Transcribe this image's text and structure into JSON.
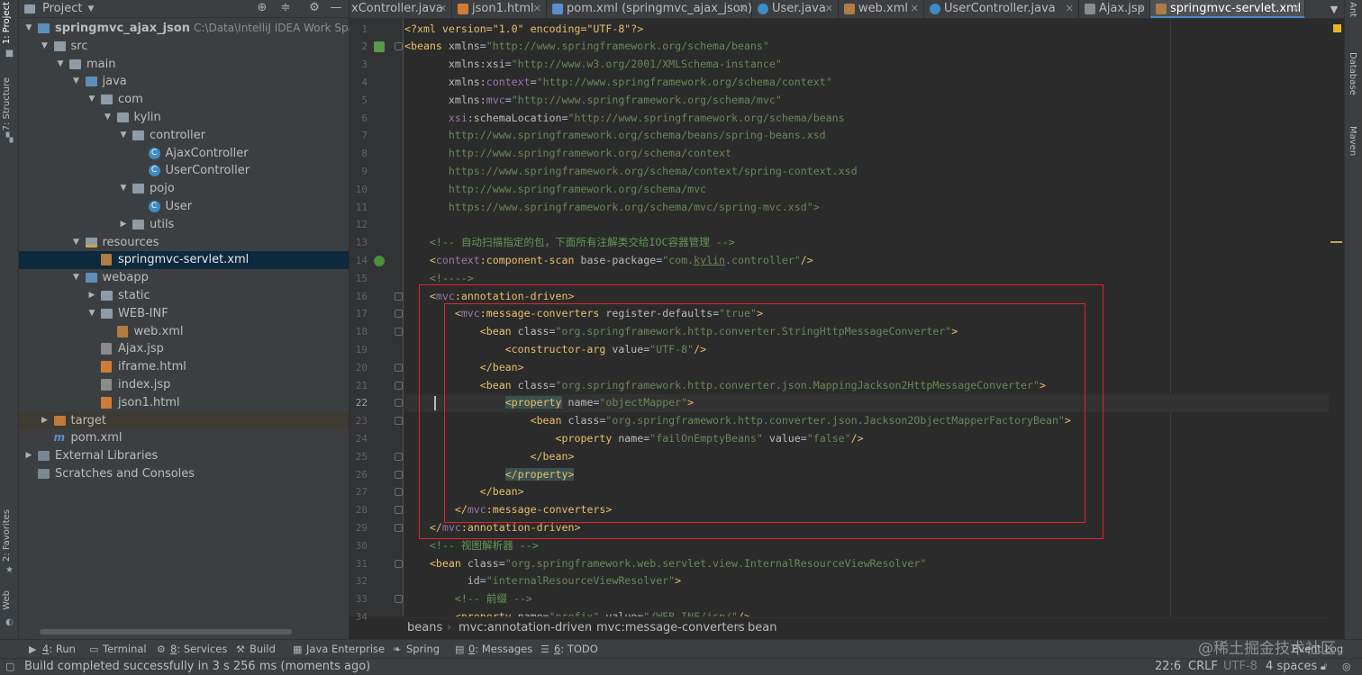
{
  "side_tabs_left": [
    "1: Project",
    "7: Structure",
    "2: Favorites",
    "Web"
  ],
  "side_tabs_right": [
    "Ant",
    "Database",
    "Maven"
  ],
  "project_panel": {
    "title": "Project",
    "tree": [
      {
        "label": "springmvc_ajax_json",
        "path": "C:\\Data\\IntelliJ IDEA Work Space\\sp",
        "icon": "module-folder"
      },
      {
        "label": "src",
        "icon": "folder"
      },
      {
        "label": "main",
        "icon": "folder"
      },
      {
        "label": "java",
        "icon": "source-folder"
      },
      {
        "label": "com",
        "icon": "package"
      },
      {
        "label": "kylin",
        "icon": "package"
      },
      {
        "label": "controller",
        "icon": "package"
      },
      {
        "label": "AjaxController",
        "icon": "class"
      },
      {
        "label": "UserController",
        "icon": "class"
      },
      {
        "label": "pojo",
        "icon": "package"
      },
      {
        "label": "User",
        "icon": "class"
      },
      {
        "label": "utils",
        "icon": "package"
      },
      {
        "label": "resources",
        "icon": "resources-folder"
      },
      {
        "label": "springmvc-servlet.xml",
        "icon": "xml-file"
      },
      {
        "label": "webapp",
        "icon": "web-folder"
      },
      {
        "label": "static",
        "icon": "folder"
      },
      {
        "label": "WEB-INF",
        "icon": "folder"
      },
      {
        "label": "web.xml",
        "icon": "xml-file"
      },
      {
        "label": "Ajax.jsp",
        "icon": "jsp-file"
      },
      {
        "label": "iframe.html",
        "icon": "html-file"
      },
      {
        "label": "index.jsp",
        "icon": "jsp-file"
      },
      {
        "label": "json1.html",
        "icon": "html-file"
      },
      {
        "label": "target",
        "icon": "excluded-folder"
      },
      {
        "label": "pom.xml",
        "icon": "maven-file"
      },
      {
        "label": "External Libraries",
        "icon": "libraries"
      },
      {
        "label": "Scratches and Consoles",
        "icon": "scratches"
      }
    ]
  },
  "editor_tabs": [
    {
      "label": "xController.java",
      "icon": "class"
    },
    {
      "label": "json1.html",
      "icon": "html-file"
    },
    {
      "label": "pom.xml (springmvc_ajax_json)",
      "icon": "maven-file"
    },
    {
      "label": "User.java",
      "icon": "class"
    },
    {
      "label": "web.xml",
      "icon": "xml-file"
    },
    {
      "label": "UserController.java",
      "icon": "class"
    },
    {
      "label": "Ajax.jsp",
      "icon": "jsp-file"
    },
    {
      "label": "springmvc-servlet.xml",
      "icon": "xml-file",
      "active": true
    }
  ],
  "editor": {
    "first_line_number": 1,
    "current_line": 22,
    "lines": [
      [
        [
          "<?xml version=\"1.0\" encoding=\"UTF-8\"?>",
          "pi"
        ]
      ],
      [
        [
          "<beans ",
          "tag"
        ],
        [
          "xmlns",
          "attr"
        ],
        [
          "=",
          "text"
        ],
        [
          "\"http://www.springframework.org/schema/beans\"",
          "val"
        ]
      ],
      [
        [
          "       xmlns:xsi",
          "attr"
        ],
        [
          "=",
          "text"
        ],
        [
          "\"http://www.w3.org/2001/XMLSchema-instance\"",
          "val"
        ]
      ],
      [
        [
          "       xmlns:",
          "attr"
        ],
        [
          "context",
          "ns"
        ],
        [
          "=",
          "text"
        ],
        [
          "\"http://www.springframework.org/schema/context\"",
          "val"
        ]
      ],
      [
        [
          "       xmlns:",
          "attr"
        ],
        [
          "mvc",
          "ns"
        ],
        [
          "=",
          "text"
        ],
        [
          "\"http://www.springframework.org/schema/mvc\"",
          "val"
        ]
      ],
      [
        [
          "       xsi",
          "ns"
        ],
        [
          ":schemaLocation",
          "attr"
        ],
        [
          "=",
          "text"
        ],
        [
          "\"http://www.springframework.org/schema/beans",
          "val"
        ]
      ],
      [
        [
          "       http://www.springframework.org/schema/beans/spring-beans.xsd",
          "val"
        ]
      ],
      [
        [
          "       http://www.springframework.org/schema/context",
          "val"
        ]
      ],
      [
        [
          "       https://www.springframework.org/schema/context/spring-context.xsd",
          "val"
        ]
      ],
      [
        [
          "       http://www.springframework.org/schema/mvc",
          "val"
        ]
      ],
      [
        [
          "       https://www.springframework.org/schema/mvc/spring-mvc.xsd\">",
          "val"
        ]
      ],
      [
        [
          "",
          "text"
        ]
      ],
      [
        [
          "    <!-- 自动扫描指定的包，下面所有注解类交给IOC容器管理 -->",
          "comment"
        ]
      ],
      [
        [
          "    <",
          "tag"
        ],
        [
          "context",
          "ns"
        ],
        [
          ":component-scan ",
          "tag"
        ],
        [
          "base-package",
          "attr"
        ],
        [
          "=",
          "text"
        ],
        [
          "\"com.",
          "val"
        ],
        [
          "kylin",
          "valu"
        ],
        [
          ".controller\"",
          "val"
        ],
        [
          "/>",
          "tag"
        ]
      ],
      [
        [
          "    <!---->",
          "comment"
        ]
      ],
      [
        [
          "    <",
          "tag"
        ],
        [
          "mvc",
          "ns"
        ],
        [
          ":annotation-driven>",
          "tag"
        ]
      ],
      [
        [
          "        <",
          "tag"
        ],
        [
          "mvc",
          "ns"
        ],
        [
          ":message-converters ",
          "tag"
        ],
        [
          "register-defaults",
          "attr"
        ],
        [
          "=",
          "text"
        ],
        [
          "\"true\"",
          "val"
        ],
        [
          ">",
          "tag"
        ]
      ],
      [
        [
          "            <bean ",
          "tag"
        ],
        [
          "class",
          "attr"
        ],
        [
          "=",
          "text"
        ],
        [
          "\"org.springframework.http.converter.StringHttpMessageConverter\"",
          "val"
        ],
        [
          ">",
          "tag"
        ]
      ],
      [
        [
          "                <constructor-arg ",
          "tag"
        ],
        [
          "value",
          "attr"
        ],
        [
          "=",
          "text"
        ],
        [
          "\"UTF-8\"",
          "val"
        ],
        [
          "/>",
          "tag"
        ]
      ],
      [
        [
          "            </bean>",
          "tag"
        ]
      ],
      [
        [
          "            <bean ",
          "tag"
        ],
        [
          "class",
          "attr"
        ],
        [
          "=",
          "text"
        ],
        [
          "\"org.springframework.http.converter.json.MappingJackson2HttpMessageConverter\"",
          "val"
        ],
        [
          ">",
          "tag"
        ]
      ],
      [
        [
          "                ",
          "text"
        ],
        [
          "<property",
          "tagm"
        ],
        [
          " ",
          "text"
        ],
        [
          "name",
          "attr"
        ],
        [
          "=",
          "text"
        ],
        [
          "\"objectMapper\"",
          "val"
        ],
        [
          ">",
          "tag"
        ]
      ],
      [
        [
          "                    <bean ",
          "tag"
        ],
        [
          "class",
          "attr"
        ],
        [
          "=",
          "text"
        ],
        [
          "\"org.springframework.http.converter.json.Jackson2ObjectMapperFactoryBean\"",
          "val"
        ],
        [
          ">",
          "tag"
        ]
      ],
      [
        [
          "                        <property ",
          "tag"
        ],
        [
          "name",
          "attr"
        ],
        [
          "=",
          "text"
        ],
        [
          "\"failOnEmptyBeans\"",
          "val"
        ],
        [
          " ",
          "text"
        ],
        [
          "value",
          "attr"
        ],
        [
          "=",
          "text"
        ],
        [
          "\"false\"",
          "val"
        ],
        [
          "/>",
          "tag"
        ]
      ],
      [
        [
          "                    </bean>",
          "tag"
        ]
      ],
      [
        [
          "                ",
          "text"
        ],
        [
          "</property",
          "tag"
        ],
        [
          ">",
          "tagm"
        ]
      ],
      [
        [
          "            </bean>",
          "tag"
        ]
      ],
      [
        [
          "        </",
          "tag"
        ],
        [
          "mvc",
          "ns"
        ],
        [
          ":message-converters>",
          "tag"
        ]
      ],
      [
        [
          "    </",
          "tag"
        ],
        [
          "mvc",
          "ns"
        ],
        [
          ":annotation-driven>",
          "tag"
        ]
      ],
      [
        [
          "    <!-- 视图解析器 -->",
          "comment"
        ]
      ],
      [
        [
          "    <bean ",
          "tag"
        ],
        [
          "class",
          "attr"
        ],
        [
          "=",
          "text"
        ],
        [
          "\"org.springframework.web.servlet.view.InternalResourceViewResolver\"",
          "val"
        ]
      ],
      [
        [
          "          id",
          "attr"
        ],
        [
          "=",
          "text"
        ],
        [
          "\"internalResourceViewResolver\"",
          "val"
        ],
        [
          ">",
          "tag"
        ]
      ],
      [
        [
          "        <!-- 前缀 -->",
          "comment"
        ]
      ],
      [
        [
          "        <property ",
          "tag"
        ],
        [
          "name",
          "attr"
        ],
        [
          "=",
          "text"
        ],
        [
          "\"prefix\" ",
          "val"
        ],
        [
          "value",
          "attr"
        ],
        [
          "=",
          "text"
        ],
        [
          "\"/WEB-INF/jsp/\"",
          "val"
        ],
        [
          "/>",
          "tag"
        ]
      ]
    ]
  },
  "breadcrumb": [
    "beans",
    "mvc:annotation-driven",
    "mvc:message-converters",
    "bean"
  ],
  "tool_windows": [
    {
      "key": "4",
      "label": ": Run",
      "icon": "run-icon"
    },
    {
      "key": "",
      "label": "Terminal",
      "icon": "terminal-icon"
    },
    {
      "key": "8",
      "label": ": Services",
      "icon": "services-icon"
    },
    {
      "key": "",
      "label": "Build",
      "icon": "build-icon"
    },
    {
      "key": "",
      "label": "Java Enterprise",
      "icon": "java-enterprise-icon"
    },
    {
      "key": "",
      "label": "Spring",
      "icon": "spring-icon"
    },
    {
      "key": "0",
      "label": ": Messages",
      "icon": "messages-icon"
    },
    {
      "key": "6",
      "label": ": TODO",
      "icon": "todo-icon"
    }
  ],
  "event_log": "Event Log",
  "status": {
    "message": "Build completed successfully in 3 s 256 ms (moments ago)",
    "position": "22:6",
    "line_separator": "CRLF",
    "encoding": "UTF-8",
    "indent": "4 spaces"
  },
  "watermark": "@稀土掘金技术社区",
  "colors": {
    "tag": "#e8bf6a",
    "attr": "#bababa",
    "value": "#6a8759",
    "ns": "#9876aa",
    "comment": "#629755",
    "pi": "#e8bf6a",
    "highlight_box": "#e0242b",
    "selected_row": "#0d293e"
  }
}
